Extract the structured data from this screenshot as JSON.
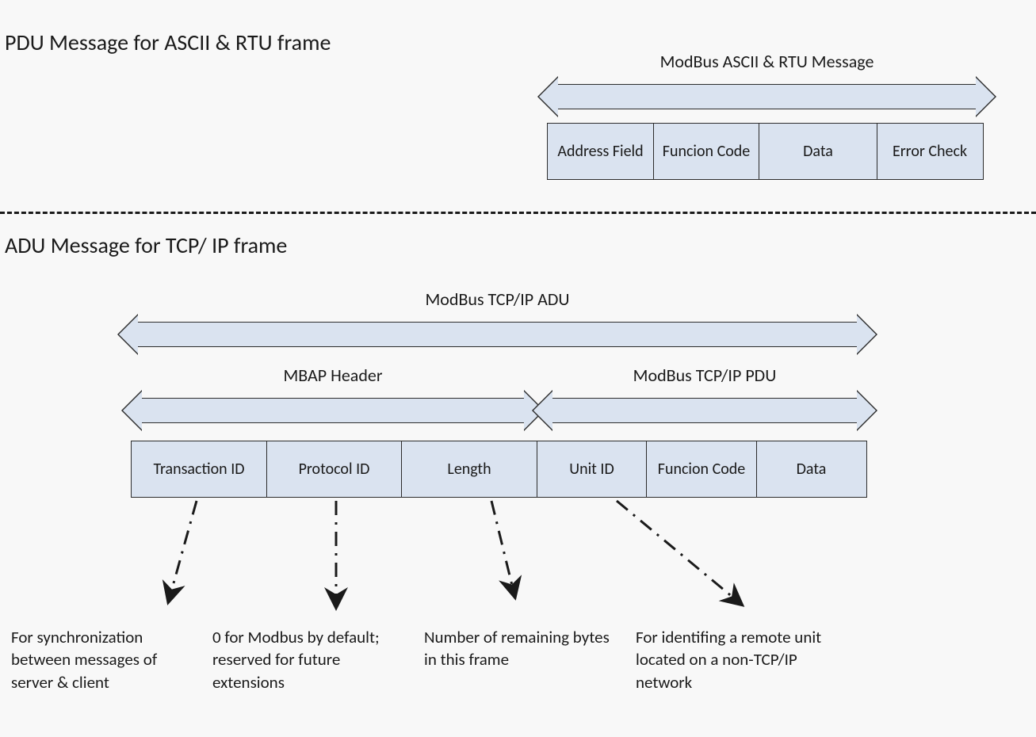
{
  "section1": {
    "heading": "PDU Message for ASCII & RTU frame",
    "arrow_label": "ModBus ASCII & RTU Message",
    "cells": [
      "Address Field",
      "Funcion Code",
      "Data",
      "Error Check"
    ]
  },
  "section2": {
    "heading": "ADU Message for TCP/ IP frame",
    "arrow_adu": "ModBus TCP/IP ADU",
    "arrow_mbap": "MBAP Header",
    "arrow_pdu": "ModBus TCP/IP PDU",
    "cells": [
      "Transaction ID",
      "Protocol ID",
      "Length",
      "Unit ID",
      "Funcion Code",
      "Data"
    ],
    "notes": {
      "transaction": "For synchronization between messages of server  & client",
      "protocol": "0 for Modbus by default; reserved for future extensions",
      "length": "Number of remaining bytes in this frame",
      "unit": "For identifing a remote unit located on a non-TCP/IP network"
    }
  }
}
